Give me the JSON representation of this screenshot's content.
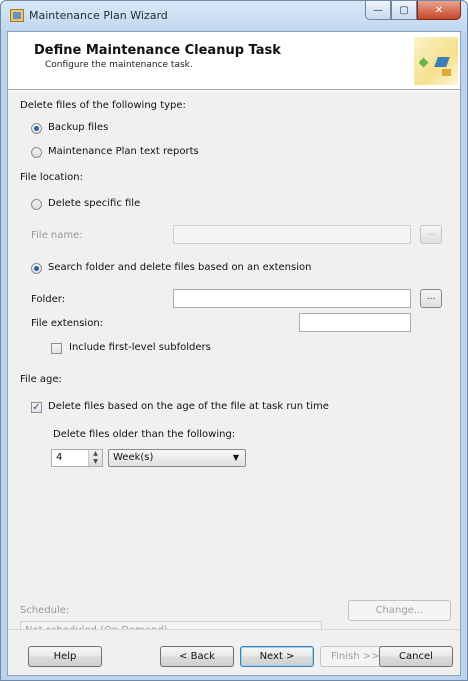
{
  "window": {
    "title": "Maintenance Plan Wizard"
  },
  "caption_buttons": {
    "minimize": "—",
    "maximize": "▢",
    "close": "✕"
  },
  "header": {
    "title": "Define Maintenance Cleanup Task",
    "subtitle": "Configure the maintenance task."
  },
  "file_type": {
    "label": "Delete files of the following type:",
    "backup_files": {
      "label": "Backup files",
      "selected": true
    },
    "text_reports": {
      "label": "Maintenance Plan text reports",
      "selected": false
    }
  },
  "location": {
    "label": "File location:",
    "specific_file": {
      "label": "Delete specific file",
      "selected": false
    },
    "file_name": {
      "label": "File name:",
      "value": "",
      "browse_label": "..."
    },
    "search_folder": {
      "label": "Search folder and delete files based on an extension",
      "selected": true
    },
    "folder": {
      "label": "Folder:",
      "value": "",
      "browse_label": "..."
    },
    "file_extension": {
      "label": "File extension:",
      "value": ""
    },
    "include_subfolders": {
      "label": "Include first-level subfolders",
      "checked": false
    }
  },
  "age": {
    "label": "File age:",
    "delete_by_age": {
      "label": "Delete files based on the age of the file at task run time",
      "checked": true
    },
    "older_than_label": "Delete files older than the following:",
    "amount": "4",
    "unit": "Week(s)"
  },
  "schedule": {
    "label": "Schedule:",
    "value": "Not scheduled (On Demand)",
    "change_label": "Change..."
  },
  "footer": {
    "help": "Help",
    "back": "< Back",
    "next": "Next >",
    "finish": "Finish >>|",
    "cancel": "Cancel"
  },
  "icons": {
    "app_icon": "maintenance-plan-icon",
    "header_graphic": "wizard-banner-icon"
  },
  "colors": {
    "titlebar": "#c2d8ef",
    "selection": "#2a5fa8",
    "close_button": "#c8452a"
  }
}
